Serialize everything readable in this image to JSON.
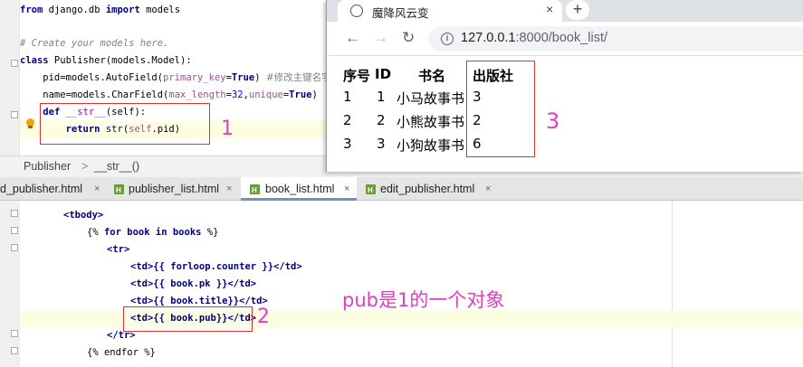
{
  "models_code": {
    "line1": {
      "kw1": "from",
      "mod": " django.db ",
      "kw2": "import",
      "name": " models"
    },
    "line3": "# Create your models here.",
    "line4": {
      "kw": "class",
      "rest": " Publisher(models.Model):"
    },
    "line5": {
      "a": "    pid=models.AutoField(",
      "b": "primary_key",
      "c": "=",
      "d": "True",
      "e": ") ",
      "comment": "#修改主键名字"
    },
    "line6": {
      "a": "    name=models.CharField(",
      "b": "max_length",
      "c": "=",
      "d": "32",
      "e": ",",
      "f": "unique",
      "g": "=",
      "h": "True",
      "i": ")"
    },
    "line7": {
      "kw": "def",
      "name": " __str__",
      "args": "(self):"
    },
    "line8": {
      "kw": "return",
      "fn": " str",
      "a": "(",
      "self": "self",
      "b": ".pid)"
    }
  },
  "breadcrumb": {
    "item1": "Publisher",
    "sep": ">",
    "item2": "__str__()"
  },
  "tabs": [
    {
      "label": "d_publisher.html"
    },
    {
      "label": "publisher_list.html"
    },
    {
      "label": "book_list.html"
    },
    {
      "label": "edit_publisher.html"
    }
  ],
  "template_code": {
    "tbody": "<tbody>",
    "for": {
      "open": "{% ",
      "kw": "for",
      "a": " book ",
      "kw2": "in",
      "b": " books ",
      "close": "%}"
    },
    "tr_open": "<tr>",
    "td1": {
      "open": "<td>",
      "body": "{{ forloop.counter }}",
      "close": "</td>"
    },
    "td2": {
      "open": "<td>",
      "body": "{{ book.pk }}",
      "close": "</td>"
    },
    "td3": {
      "open": "<td>",
      "body": "{{ book.title}}",
      "close": "</td>"
    },
    "td4": {
      "open": "<td>",
      "body": "{{ book.pub}}",
      "close": "</td>"
    },
    "tr_close": "</tr>",
    "endfor": "{% endfor %}"
  },
  "annotations": {
    "label1": "1",
    "label2": "2",
    "label3": "3",
    "note": "pub是1的一个对象"
  },
  "browser": {
    "tab_title": "魔降风云变",
    "tab_close": "×",
    "new_tab": "+",
    "back": "←",
    "forward": "→",
    "reload": "↻",
    "info": "i",
    "url_host": "127.0.0.1",
    "url_rest": ":8000/book_list/",
    "table": {
      "headers": [
        "序号",
        "ID",
        "书名",
        "出版社"
      ],
      "rows": [
        [
          "1",
          "1",
          "小马故事书",
          "3"
        ],
        [
          "2",
          "2",
          "小熊故事书",
          "2"
        ],
        [
          "3",
          "3",
          "小狗故事书",
          "6"
        ]
      ]
    }
  },
  "colors": {
    "annotation": "#e040c0",
    "box": "#e0332e",
    "keyword": "#000080"
  }
}
